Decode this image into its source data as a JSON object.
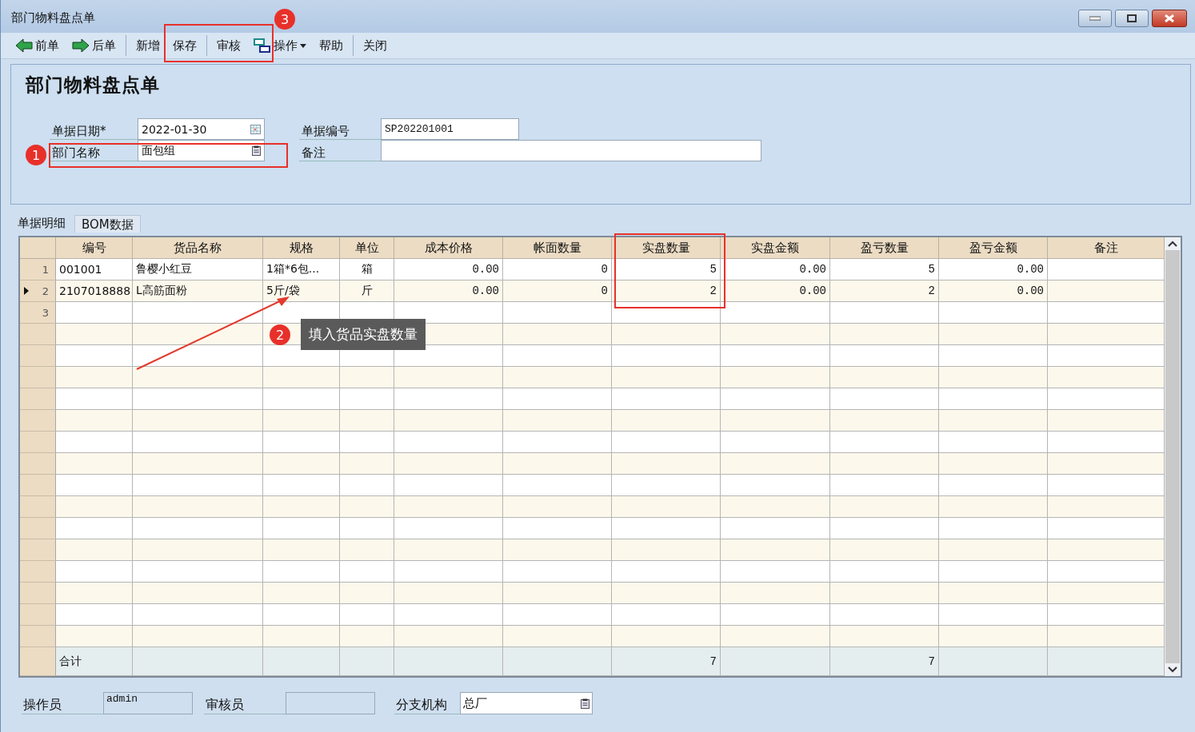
{
  "window": {
    "title": "部门物料盘点单"
  },
  "toolbar": [
    {
      "label": "前单",
      "kind": "prev"
    },
    {
      "label": "后单",
      "kind": "next"
    },
    {
      "label": "新增",
      "kind": "plain"
    },
    {
      "label": "保存",
      "kind": "plain"
    },
    {
      "label": "审核",
      "kind": "plain"
    },
    {
      "label": "操作",
      "kind": "menu"
    },
    {
      "label": "帮助",
      "kind": "plain"
    },
    {
      "label": "关闭",
      "kind": "plain"
    }
  ],
  "form": {
    "heading": "部门物料盘点单",
    "fields": [
      {
        "label": "单据日期*",
        "value": "2022-01-30",
        "kind": "date"
      },
      {
        "label": "单据编号",
        "value": "SP202201001",
        "kind": "text"
      },
      {
        "label": "部门名称",
        "value": "面包组",
        "kind": "lookup"
      },
      {
        "label": "备注",
        "kind": "wide"
      }
    ]
  },
  "tabs": [
    {
      "label": "单据明细",
      "selected": true
    },
    {
      "label": "BOM数据",
      "selected": false
    }
  ],
  "table": {
    "columns": [
      {
        "label": "编号",
        "kind": "text"
      },
      {
        "label": "货品名称",
        "kind": "text"
      },
      {
        "label": "规格",
        "kind": "text"
      },
      {
        "label": "单位",
        "kind": "center"
      },
      {
        "label": "成本价格",
        "kind": "number"
      },
      {
        "label": "帐面数量",
        "kind": "number"
      },
      {
        "label": "实盘数量",
        "kind": "number"
      },
      {
        "label": "实盘金额",
        "kind": "number"
      },
      {
        "label": "盈亏数量",
        "kind": "number"
      },
      {
        "label": "盈亏金额",
        "kind": "number"
      },
      {
        "label": "备注",
        "kind": "text"
      }
    ],
    "rows": [
      {
        "number": "1",
        "current": false,
        "cells": [
          "001001",
          "鲁樱小红豆",
          "1箱*6包...",
          "箱",
          "0.00",
          "0",
          "5",
          "0.00",
          "5",
          "0.00"
        ]
      },
      {
        "number": "2",
        "current": true,
        "cells": [
          "2107018888",
          "L高筋面粉",
          "5斤/袋",
          "斤",
          "0.00",
          "0",
          "2",
          "0.00",
          "2",
          "0.00"
        ]
      },
      {
        "number": "3",
        "current": false,
        "cells": []
      }
    ],
    "footer": {
      "label": "合计",
      "actual_quantity_total": "7",
      "profit_loss_quantity_total": "7"
    }
  },
  "bottom_fields": [
    {
      "label": "操作员",
      "value": "admin",
      "kind": "text"
    },
    {
      "label": "审核员",
      "kind": "text"
    },
    {
      "label": "分支机构",
      "value": "总厂",
      "kind": "lookup"
    }
  ],
  "annotations": [
    {
      "number": "3"
    },
    {
      "number": "1"
    },
    {
      "number": "2",
      "callout": "填入货品实盘数量"
    }
  ]
}
